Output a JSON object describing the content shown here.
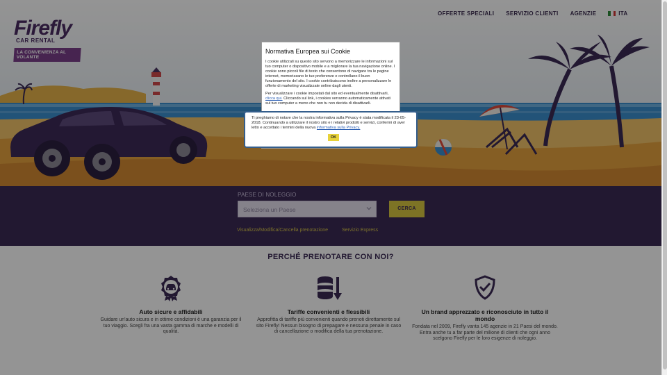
{
  "header": {
    "logo": {
      "wordmark": "Firefly",
      "subtitle": "CAR RENTAL",
      "tagline": "LA CONVENIENZA AL VOLANTE"
    },
    "nav": [
      {
        "label": "OFFERTE SPECIALI"
      },
      {
        "label": "SERVIZIO CLIENTI"
      },
      {
        "label": "AGENZIE"
      }
    ],
    "language": {
      "label": "ITA",
      "flag_icon": "italy-flag-icon"
    }
  },
  "search": {
    "label": "PAESE DI NOLEGGIO",
    "placeholder": "Seleziona un Paese",
    "button": "CERCA",
    "links": [
      {
        "label": "Visualizza/Modifica/Cancella prenotazione"
      },
      {
        "label": "Servizio Express"
      }
    ]
  },
  "why": {
    "title": "PERCHÉ PRENOTARE CON NOI?",
    "features": [
      {
        "icon": "car-badge-icon",
        "title": "Auto sicure e affidabili",
        "text": "Guidare un'auto sicura e in ottime condizioni è una garanzia per il tuo viaggio. Scegli fra una vasta gamma di marche e modelli di qualità."
      },
      {
        "icon": "coins-down-arrow-icon",
        "title": "Tariffe convenienti e flessibili",
        "text": "Approfitta di tariffe più convenienti quando prenoti direttamente sul sito Firefly! Nessun bisogno di prepagare e nessuna penale in caso di cancellazione o modifica della tua prenotazione."
      },
      {
        "icon": "shield-check-icon",
        "title": "Un brand apprezzato e riconosciuto in tutto il mondo",
        "text": "Fondata nel 2009, Firefly vanta 145 agenzie in 21 Paesi del mondo. Entra anche tu a far parte del milione di clienti che ogni anno scelgono Firefly per le loro esigenze di noleggio."
      }
    ]
  },
  "cookie_dialog": {
    "title": "Normativa Europea sui Cookie",
    "paragraph1": "I cookie utilizzati su questo sito servono a memorizzare le informazioni sul tuo computer o dispositivo mobile e a migliorare la tua navigazione online. I cookie sono piccoli file di testo che consentono di navigare tra le pagine internet, memorizzano le tue preferenze e controllano il buon funzionamento del sito. I cookie contribuiscono inoltre a personalizzare le offerte di marketing visualizzate online dagli utenti.",
    "paragraph2_before": "Per visualizzare i cookie impostati dal sito ed eventualmente disattivarli,",
    "paragraph2_link": "clicca qui.",
    "paragraph2_after": "Cliccando sul link, i cookies verranno automaticamente attivati sul tuo computer a meno che non tu non decida di disattivarli."
  },
  "privacy_notice": {
    "text": "Ti preghiamo di notare che la nostra informativa sulla Privacy è stata modificata il 23-05-2018. Continuando a utilizzare il nostro sito e i relativi prodotti e servizi, confermi di aver letto e accettato i termini della nuova",
    "link": "informativa sulla Privacy.",
    "ok_button": "OK"
  },
  "colors": {
    "brand_purple": "#3b2a55",
    "accent_yellow": "#d8c640",
    "link_yellow": "#d6c34a",
    "dialog_border": "#345e8c"
  }
}
